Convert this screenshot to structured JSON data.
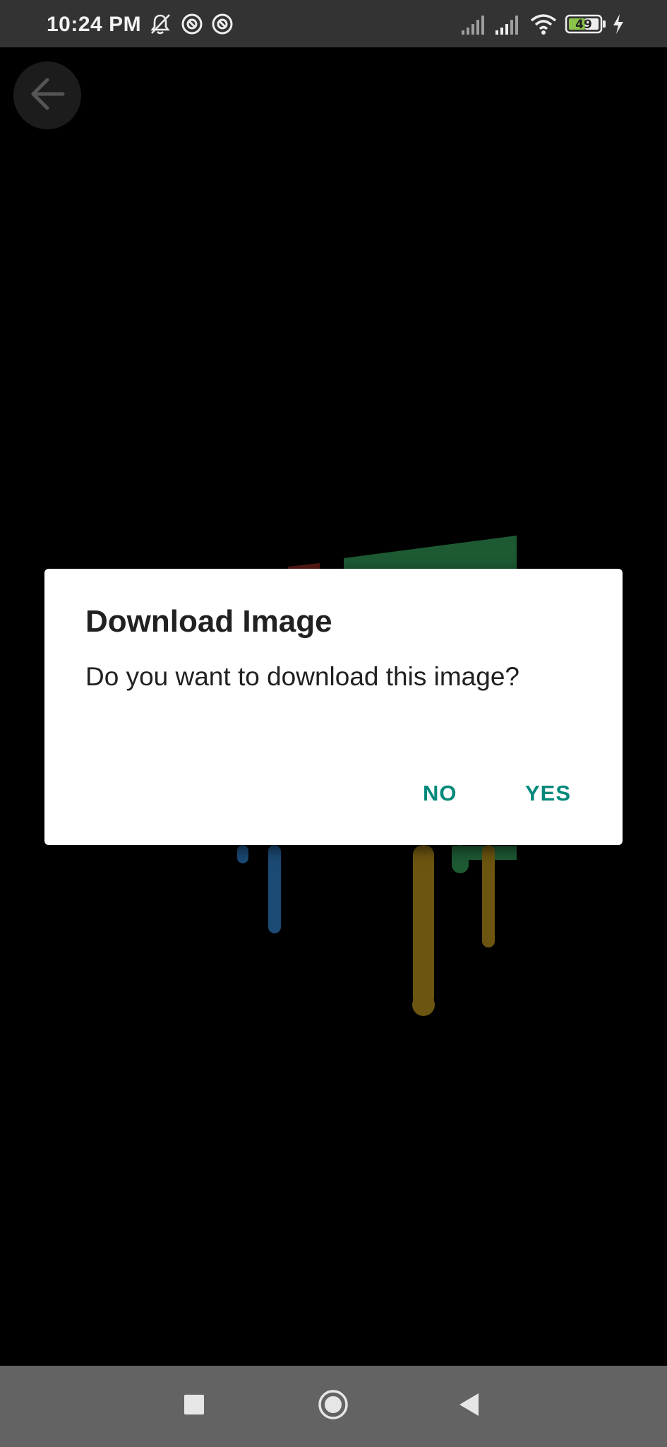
{
  "status_bar": {
    "time": "10:24 PM",
    "battery_level": "49",
    "icons": [
      "bell-off-icon",
      "sync-icon",
      "sync-icon",
      "signal-icon",
      "signal-icon",
      "wifi-icon",
      "battery-icon",
      "charging-icon"
    ]
  },
  "header": {
    "back_icon": "arrow-left-icon"
  },
  "dialog": {
    "title": "Download Image",
    "message": "Do you want to download this image?",
    "no_label": "NO",
    "yes_label": "YES",
    "accent_color": "#00897b"
  },
  "nav_bar": {
    "icons": [
      "recents-square-icon",
      "home-circle-icon",
      "back-triangle-icon"
    ]
  }
}
